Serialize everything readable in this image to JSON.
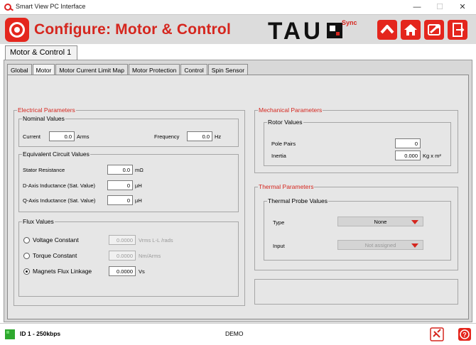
{
  "window": {
    "title": "Smart View PC Interface",
    "minimize": "—",
    "maximize": "☐",
    "close": "✕"
  },
  "header": {
    "title": "Configure: Motor & Control",
    "brand": "TAU",
    "brand_suffix": "Sync",
    "buttons": [
      "up-arrow-icon",
      "home-icon",
      "wrench-icon",
      "exit-icon"
    ]
  },
  "group_tab": "Motor & Control 1",
  "tabs": [
    "Global",
    "Motor",
    "Motor Current Limit Map",
    "Motor Protection",
    "Control",
    "Spin Sensor"
  ],
  "active_tab": "Motor",
  "electrical": {
    "legend": "Electrical Parameters",
    "nominal": {
      "legend": "Nominal Values",
      "current_label": "Current",
      "current_value": "0.0",
      "current_unit": "Arms",
      "frequency_label": "Frequency",
      "frequency_value": "0.0",
      "frequency_unit": "Hz"
    },
    "equivalent": {
      "legend": "Equivalent Circuit Values",
      "stator_label": "Stator Resistance",
      "stator_value": "0.0",
      "stator_unit": "mΩ",
      "daxis_label": "D-Axis Inductance (Sat. Value)",
      "daxis_value": "0",
      "daxis_unit": "µH",
      "qaxis_label": "Q-Axis Inductance (Sat. Value)",
      "qaxis_value": "0",
      "qaxis_unit": "µH"
    },
    "flux": {
      "legend": "Flux Values",
      "voltage_label": "Voltage Constant",
      "voltage_value": "0.0000",
      "voltage_unit": "Vrms L-L /rads",
      "torque_label": "Torque Constant",
      "torque_value": "0.0000",
      "torque_unit": "Nm/Arms",
      "magnets_label": "Magnets Flux Linkage",
      "magnets_value": "0.0000",
      "magnets_unit": "Vs",
      "selected": "Magnets Flux Linkage"
    }
  },
  "mechanical": {
    "legend": "Mechanical Parameters",
    "rotor": {
      "legend": "Rotor Values",
      "pole_label": "Pole Pairs",
      "pole_value": "0",
      "inertia_label": "Inertia",
      "inertia_value": "0.000",
      "inertia_unit": "Kg x m²"
    }
  },
  "thermal": {
    "legend": "Thermal Parameters",
    "probe": {
      "legend": "Thermal Probe Values",
      "type_label": "Type",
      "type_value": "None",
      "input_label": "Input",
      "input_value": "Not assigned"
    }
  },
  "status": {
    "id": "ID 1 - 250kbps",
    "mode": "DEMO"
  },
  "colors": {
    "accent": "#d5261e",
    "panel": "#d8d8d8",
    "content": "#e6e6e6",
    "connected": "#2ea82e"
  }
}
